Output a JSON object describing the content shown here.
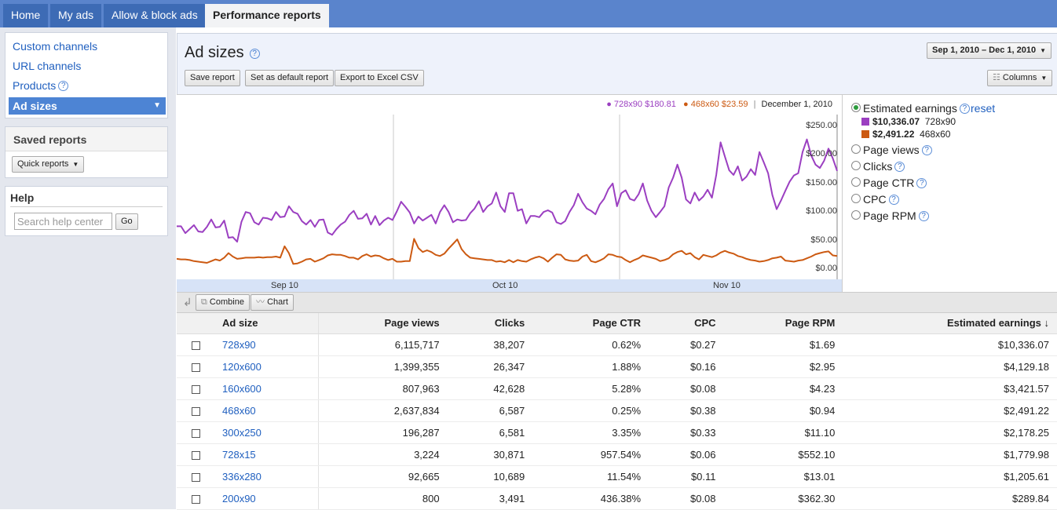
{
  "nav": {
    "tabs": [
      "Home",
      "My ads",
      "Allow & block ads",
      "Performance reports"
    ],
    "active_tab": "Performance reports"
  },
  "sidebar": {
    "links": [
      "Custom channels",
      "URL channels",
      "Products"
    ],
    "selected": "Ad sizes",
    "saved_reports_title": "Saved reports",
    "quick_reports_label": "Quick reports",
    "help_title": "Help",
    "help_search_placeholder": "Search help center",
    "go_label": "Go"
  },
  "header": {
    "title": "Ad sizes",
    "buttons": [
      "Save report",
      "Set as default report",
      "Export to Excel CSV"
    ],
    "date_range": "Sep 1, 2010 – Dec 1, 2010",
    "columns_label": "Columns",
    "help_glyph": "?"
  },
  "chart_legend": {
    "series1": "● 728x90 $180.81",
    "series2": "● 468x60 $23.59",
    "date": "December 1, 2010"
  },
  "chart_data": {
    "type": "line",
    "x_start": "2010-09-01",
    "x_end": "2010-12-01",
    "x_tick_labels": [
      "Sep 10",
      "Oct 10",
      "Nov 10"
    ],
    "y_tick_labels": [
      "$250.00",
      "$200.00",
      "$150.00",
      "$100.00",
      "$50.00",
      "$0.00"
    ],
    "ylim": [
      0,
      250
    ],
    "grid": "vertical",
    "series": [
      {
        "name": "728x90",
        "color": "#9b3fc1",
        "values": [
          75,
          75,
          63,
          70,
          77,
          66,
          65,
          74,
          87,
          73,
          74,
          85,
          55,
          56,
          48,
          83,
          100,
          98,
          82,
          78,
          90,
          89,
          86,
          100,
          91,
          92,
          110,
          100,
          97,
          84,
          78,
          86,
          74,
          86,
          87,
          64,
          60,
          70,
          78,
          83,
          95,
          102,
          88,
          89,
          97,
          78,
          93,
          77,
          85,
          90,
          86,
          101,
          118,
          109,
          99,
          80,
          92,
          85,
          90,
          95,
          80,
          100,
          112,
          100,
          82,
          87,
          85,
          86,
          98,
          106,
          119,
          100,
          110,
          115,
          134,
          110,
          100,
          133,
          133,
          102,
          105,
          80,
          93,
          93,
          91,
          100,
          103,
          99,
          82,
          79,
          84,
          100,
          112,
          132,
          117,
          106,
          102,
          96,
          113,
          123,
          140,
          150,
          110,
          133,
          138,
          123,
          120,
          131,
          150,
          120,
          102,
          91,
          100,
          110,
          143,
          160,
          183,
          160,
          122,
          115,
          134,
          120,
          127,
          139,
          125,
          165,
          222,
          197,
          173,
          165,
          180,
          155,
          162,
          175,
          165,
          205,
          187,
          168,
          130,
          105,
          120,
          137,
          153,
          164,
          168,
          205,
          227,
          199,
          183,
          177,
          190,
          211,
          194,
          172
        ],
        "current": 180.81
      },
      {
        "name": "468x60",
        "color": "#cc5a12",
        "values": [
          18,
          17,
          17,
          16,
          14,
          13,
          12,
          11,
          14,
          17,
          15,
          20,
          28,
          22,
          18,
          19,
          20,
          20,
          20,
          21,
          20,
          21,
          21,
          22,
          20,
          40,
          28,
          9,
          10,
          13,
          17,
          18,
          13,
          16,
          19,
          24,
          26,
          25,
          25,
          23,
          20,
          20,
          17,
          23,
          26,
          22,
          24,
          23,
          19,
          16,
          18,
          13,
          13,
          14,
          14,
          53,
          37,
          30,
          33,
          30,
          25,
          23,
          27,
          36,
          44,
          52,
          35,
          26,
          20,
          19,
          18,
          17,
          16,
          16,
          13,
          14,
          12,
          16,
          12,
          16,
          14,
          13,
          17,
          20,
          22,
          19,
          13,
          20,
          26,
          25,
          17,
          15,
          14,
          15,
          22,
          25,
          14,
          12,
          15,
          19,
          26,
          25,
          22,
          21,
          16,
          12,
          16,
          19,
          24,
          22,
          20,
          18,
          14,
          16,
          19,
          26,
          30,
          32,
          26,
          28,
          21,
          17,
          25,
          23,
          21,
          24,
          29,
          32,
          29,
          27,
          23,
          21,
          18,
          16,
          15,
          13,
          14,
          16,
          19,
          20,
          22,
          15,
          14,
          13,
          15,
          16,
          19,
          22,
          26,
          28,
          30,
          31,
          24,
          23
        ],
        "current": 23.59
      }
    ]
  },
  "metrics": {
    "options": [
      "Estimated earnings",
      "Page views",
      "Clicks",
      "Page CTR",
      "CPC",
      "Page RPM"
    ],
    "selected": "Estimated earnings",
    "reset_label": "reset",
    "series_totals": [
      {
        "value": "$10,336.07",
        "label": "728x90",
        "color": "#9b3fc1"
      },
      {
        "value": "$2,491.22",
        "label": "468x60",
        "color": "#cc5a12"
      }
    ]
  },
  "table_toolbar": {
    "combine_label": "Combine",
    "chart_label": "Chart"
  },
  "table": {
    "columns": [
      "Ad size",
      "Page views",
      "Clicks",
      "Page CTR",
      "CPC",
      "Page RPM",
      "Estimated earnings ↓"
    ],
    "rows": [
      [
        "728x90",
        "6,115,717",
        "38,207",
        "0.62%",
        "$0.27",
        "$1.69",
        "$10,336.07"
      ],
      [
        "120x600",
        "1,399,355",
        "26,347",
        "1.88%",
        "$0.16",
        "$2.95",
        "$4,129.18"
      ],
      [
        "160x600",
        "807,963",
        "42,628",
        "5.28%",
        "$0.08",
        "$4.23",
        "$3,421.57"
      ],
      [
        "468x60",
        "2,637,834",
        "6,587",
        "0.25%",
        "$0.38",
        "$0.94",
        "$2,491.22"
      ],
      [
        "300x250",
        "196,287",
        "6,581",
        "3.35%",
        "$0.33",
        "$11.10",
        "$2,178.25"
      ],
      [
        "728x15",
        "3,224",
        "30,871",
        "957.54%",
        "$0.06",
        "$552.10",
        "$1,779.98"
      ],
      [
        "336x280",
        "92,665",
        "10,689",
        "11.54%",
        "$0.11",
        "$13.01",
        "$1,205.61"
      ],
      [
        "200x90",
        "800",
        "3,491",
        "436.38%",
        "$0.08",
        "$362.30",
        "$289.84"
      ]
    ]
  }
}
